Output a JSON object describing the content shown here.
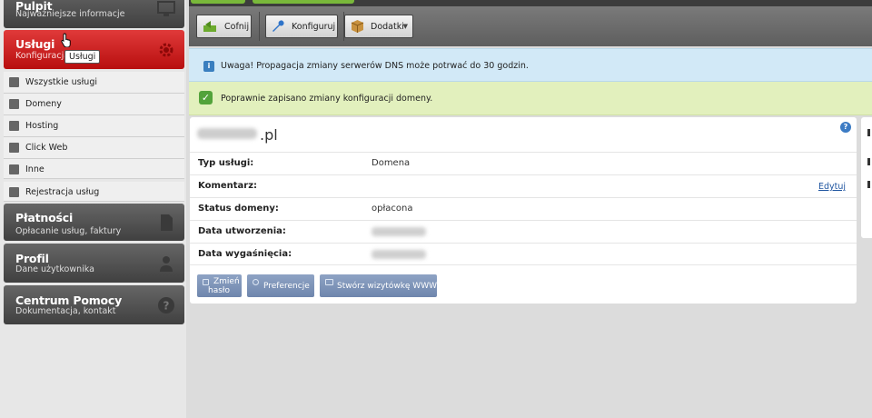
{
  "sidebar": {
    "pulpit": {
      "title": "Pulpit",
      "subtitle": "Najważniejsze informacje"
    },
    "uslugi": {
      "title": "Usługi",
      "subtitle": "Konfiguracja"
    },
    "tooltip": "Usługi",
    "subitems": [
      {
        "label": "Wszystkie usługi",
        "icon": "document-icon"
      },
      {
        "label": "Domeny",
        "icon": "domain-icon"
      },
      {
        "label": "Hosting",
        "icon": "server-icon"
      },
      {
        "label": "Click Web",
        "icon": "web-icon"
      },
      {
        "label": "Inne",
        "icon": "arrow-icon"
      },
      {
        "label": "Rejestracja usług",
        "icon": "plus-icon"
      }
    ],
    "platnosci": {
      "title": "Płatności",
      "subtitle": "Opłacanie usług, faktury"
    },
    "profil": {
      "title": "Profil",
      "subtitle": "Dane użytkownika"
    },
    "pomoc": {
      "title": "Centrum Pomocy",
      "subtitle": "Dokumentacja, kontakt"
    }
  },
  "toolbar": {
    "back_label": "Cofnij",
    "configure_label": "Konfiguruj",
    "addons_label": "Dodatki"
  },
  "alerts": {
    "info": "Uwaga! Propagacja zmiany serwerów DNS może potrwać do 30 godzin.",
    "success": "Poprawnie zapisano zmiany konfiguracji domeny."
  },
  "panel": {
    "domain_suffix": ".pl",
    "rows": [
      {
        "label": "Typ usługi:",
        "value": "Domena"
      },
      {
        "label": "Komentarz:",
        "value": "",
        "edit": "Edytuj"
      },
      {
        "label": "Status domeny:",
        "value": "opłacona"
      },
      {
        "label": "Data utworzenia:",
        "value": ""
      },
      {
        "label": "Data wygaśnięcia:",
        "value": ""
      }
    ],
    "buttons": {
      "change_password": [
        "Zmień",
        "hasło"
      ],
      "preferences": "Preferencje",
      "create_site": "Stwórz wizytówkę WWW"
    }
  },
  "colors": {
    "accent_red": "#c91c1c",
    "toolbar_gray": "#6b6b6b",
    "info_bg": "#d2e9f7",
    "success_bg": "#e2f0bd",
    "action_blue": "#7f95bb"
  }
}
